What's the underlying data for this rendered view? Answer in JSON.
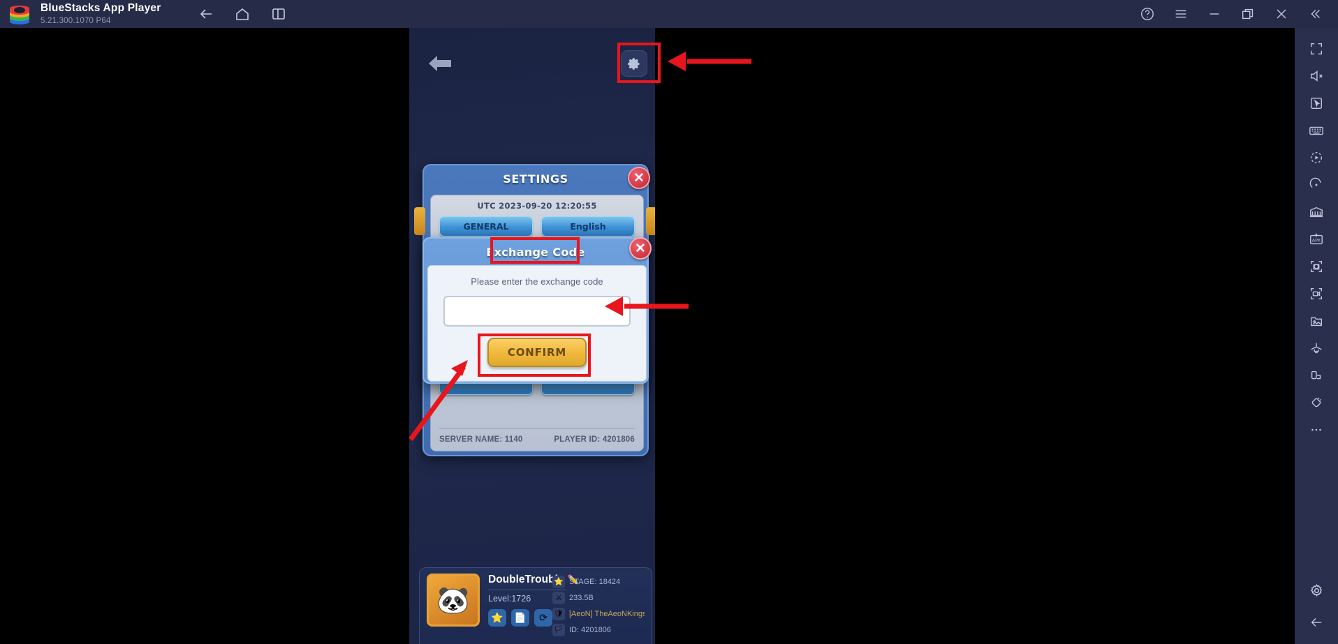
{
  "titlebar": {
    "app_title": "BlueStacks App Player",
    "version": "5.21.300.1070  P64",
    "logo_name": "bluestacks-logo",
    "nav": [
      {
        "name": "back-icon",
        "label": "Back"
      },
      {
        "name": "home-icon",
        "label": "Home"
      },
      {
        "name": "multi-instance-icon",
        "label": "Multi-instance"
      }
    ],
    "window_controls": [
      {
        "name": "help-icon",
        "label": "Help"
      },
      {
        "name": "menu-icon",
        "label": "Menu"
      },
      {
        "name": "minimize-icon",
        "label": "Minimize"
      },
      {
        "name": "restore-icon",
        "label": "Restore"
      },
      {
        "name": "close-icon",
        "label": "Close"
      },
      {
        "name": "collapse-sidebar-icon",
        "label": "Collapse"
      }
    ]
  },
  "sidebar": {
    "items": [
      {
        "name": "fullscreen-icon",
        "label": "Fullscreen"
      },
      {
        "name": "mute-icon",
        "label": "Mute"
      },
      {
        "name": "pointer-icon",
        "label": "Game controls"
      },
      {
        "name": "keyboard-icon",
        "label": "Keyboard controls"
      },
      {
        "name": "macro-icon",
        "label": "Macro recorder"
      },
      {
        "name": "rotate-icon",
        "label": "Rotate"
      },
      {
        "name": "multi-instance-manager-icon",
        "label": "Instance manager"
      },
      {
        "name": "install-apk-icon",
        "label": "Install APK"
      },
      {
        "name": "screenshot-icon",
        "label": "Screenshot"
      },
      {
        "name": "record-screen-icon",
        "label": "Record screen"
      },
      {
        "name": "media-manager-icon",
        "label": "Media manager"
      },
      {
        "name": "eco-mode-icon",
        "label": "Eco mode"
      },
      {
        "name": "app-center-icon",
        "label": "App center"
      },
      {
        "name": "shake-icon",
        "label": "Shake"
      },
      {
        "name": "more-icon",
        "label": "More"
      },
      {
        "name": "settings-gear-icon",
        "label": "Settings"
      },
      {
        "name": "back-arrow-icon",
        "label": "Back"
      }
    ]
  },
  "game": {
    "back_button": "back-arrow",
    "gear_button": "gear",
    "settings": {
      "title": "SETTINGS",
      "utc_line": "UTC 2023-09-20 12:20:55",
      "buttons": [
        {
          "label": "GENERAL"
        },
        {
          "label": "English"
        }
      ],
      "server_name": "SERVER NAME: 1140",
      "player_id": "PLAYER ID: 4201806",
      "close_label": "✕"
    },
    "exchange": {
      "title": "Exchange Code",
      "hint": "Please enter the exchange code",
      "input_value": "",
      "input_placeholder": "",
      "confirm_label": "CONFIRM",
      "close_label": "✕"
    },
    "player": {
      "name": "DoubleTrouble",
      "edit_icon": "pencil-icon",
      "level": "Level:1726",
      "gender": "♂",
      "icons": [
        {
          "name": "star-icon",
          "glyph": "⭐"
        },
        {
          "name": "notes-icon",
          "glyph": "📄"
        },
        {
          "name": "refresh-icon",
          "glyph": "⟳"
        }
      ],
      "stats": [
        {
          "icon": "star-badge-icon",
          "glyph": "★",
          "text": "STAGE: 18424"
        },
        {
          "icon": "swords-icon",
          "glyph": "⚔",
          "text": "233.5B"
        },
        {
          "icon": "guild-icon",
          "glyph": "♖",
          "text": "[AeoN] TheAeoNKings",
          "kind": "guild"
        },
        {
          "icon": "flag-icon",
          "glyph": "⚑",
          "text": "ID: 4201806"
        }
      ]
    }
  },
  "annotations": {
    "color": "#e8161c",
    "highlights": [
      {
        "name": "highlight-gear-button"
      },
      {
        "name": "highlight-exchange-code-title"
      },
      {
        "name": "highlight-confirm-button"
      }
    ],
    "arrows": [
      {
        "name": "arrow-to-gear-button"
      },
      {
        "name": "arrow-to-input-field"
      },
      {
        "name": "arrow-to-dialog"
      }
    ]
  }
}
